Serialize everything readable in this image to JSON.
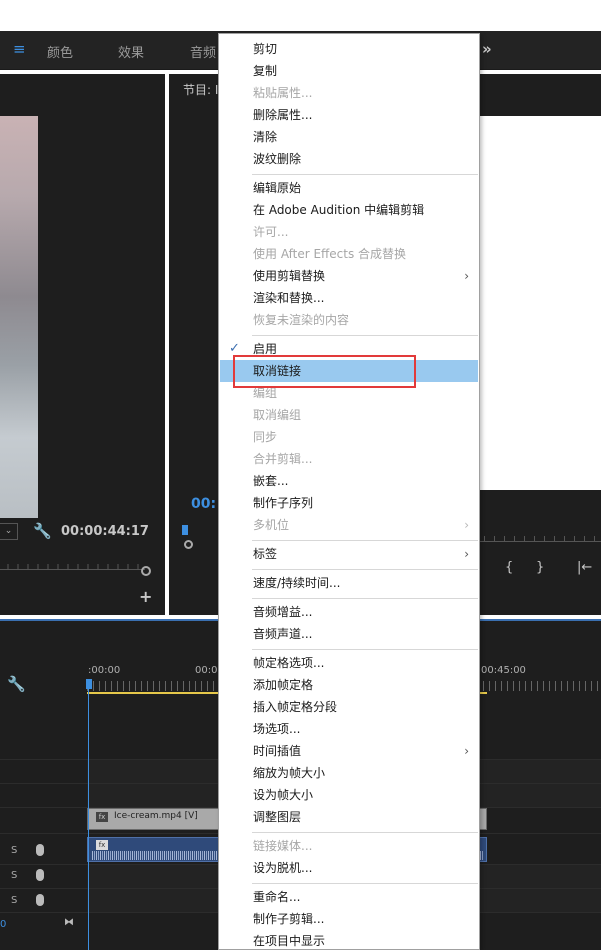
{
  "workspace": {
    "tabs": [
      "颜色",
      "效果",
      "音频"
    ],
    "more_icon": "»"
  },
  "source_monitor": {
    "timecode": "00:00:44:17"
  },
  "program_monitor": {
    "title": "节目: I",
    "timecode": "00:",
    "buttons": [
      "{",
      "}",
      "|←"
    ]
  },
  "timeline": {
    "ruler_labels": [
      ":00:00",
      "00:0",
      "00:45:00"
    ],
    "video_clip_label": "Ice-cream.mp4 [V]",
    "fx_badge": "fx",
    "track_solo_label": "S",
    "volume_value": "0"
  },
  "context_menu": {
    "items": [
      {
        "label": "剪切",
        "state": "enabled"
      },
      {
        "label": "复制",
        "state": "enabled"
      },
      {
        "label": "粘贴属性...",
        "state": "disabled"
      },
      {
        "label": "删除属性...",
        "state": "enabled"
      },
      {
        "label": "清除",
        "state": "enabled"
      },
      {
        "label": "波纹删除",
        "state": "enabled"
      },
      {
        "label": "编辑原始",
        "state": "enabled"
      },
      {
        "label": "在 Adobe Audition 中编辑剪辑",
        "state": "enabled"
      },
      {
        "label": "许可...",
        "state": "disabled"
      },
      {
        "label": "使用 After Effects 合成替换",
        "state": "disabled"
      },
      {
        "label": "使用剪辑替换",
        "state": "enabled",
        "submenu": true
      },
      {
        "label": "渲染和替换...",
        "state": "enabled"
      },
      {
        "label": "恢复未渲染的内容",
        "state": "disabled"
      },
      {
        "label": "启用",
        "state": "enabled",
        "checked": true
      },
      {
        "label": "取消链接",
        "state": "highlighted"
      },
      {
        "label": "编组",
        "state": "disabled"
      },
      {
        "label": "取消编组",
        "state": "disabled"
      },
      {
        "label": "同步",
        "state": "disabled"
      },
      {
        "label": "合并剪辑...",
        "state": "disabled"
      },
      {
        "label": "嵌套...",
        "state": "enabled"
      },
      {
        "label": "制作子序列",
        "state": "enabled"
      },
      {
        "label": "多机位",
        "state": "disabled",
        "submenu": true
      },
      {
        "label": "标签",
        "state": "enabled",
        "submenu": true
      },
      {
        "label": "速度/持续时间...",
        "state": "enabled"
      },
      {
        "label": "音频增益...",
        "state": "enabled"
      },
      {
        "label": "音频声道...",
        "state": "enabled"
      },
      {
        "label": "帧定格选项...",
        "state": "enabled"
      },
      {
        "label": "添加帧定格",
        "state": "enabled"
      },
      {
        "label": "插入帧定格分段",
        "state": "enabled"
      },
      {
        "label": "场选项...",
        "state": "enabled"
      },
      {
        "label": "时间插值",
        "state": "enabled",
        "submenu": true
      },
      {
        "label": "缩放为帧大小",
        "state": "enabled"
      },
      {
        "label": "设为帧大小",
        "state": "enabled"
      },
      {
        "label": "调整图层",
        "state": "enabled"
      },
      {
        "label": "链接媒体...",
        "state": "disabled"
      },
      {
        "label": "设为脱机...",
        "state": "enabled"
      },
      {
        "label": "重命名...",
        "state": "enabled"
      },
      {
        "label": "制作子剪辑...",
        "state": "enabled"
      },
      {
        "label": "在项目中显示",
        "state": "enabled"
      }
    ],
    "checkmark": "✓",
    "submenu_arrow": "›"
  },
  "colors": {
    "highlight": "#99c9ef",
    "annotation_box": "#e23a3a",
    "accent_blue": "#3d8fe0",
    "panel_bg": "#1e1e1e"
  },
  "icons": {
    "workspace_menu": "hamburger-icon",
    "source_wrench": "wrench-icon",
    "source_add": "plus-icon",
    "timeline_wrench": "wrench-icon",
    "track_mic": "microphone-icon"
  }
}
